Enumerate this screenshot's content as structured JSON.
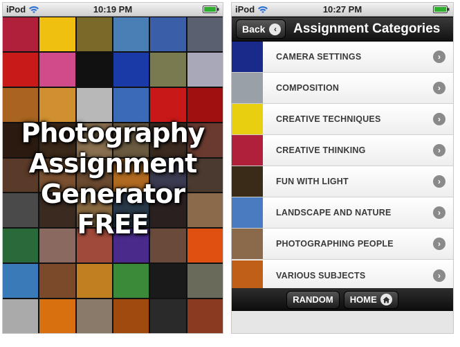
{
  "left_screen": {
    "status": {
      "carrier": "iPod",
      "time": "10:19 PM"
    },
    "title_lines": [
      "Photography",
      "Assignment",
      "Generator",
      "FREE"
    ],
    "tiles": [
      "#b0203a",
      "#f0c010",
      "#7a6a2a",
      "#4a7fb5",
      "#3a5ea8",
      "#5a6070",
      "#c91a1a",
      "#d14a8a",
      "#111111",
      "#1a3aa8",
      "#7a7a50",
      "#a8a8b8",
      "#a86420",
      "#d09030",
      "#b8b8b8",
      "#3a6ab8",
      "#c81818",
      "#a01010",
      "#2a1a10",
      "#3a2818",
      "#8a7050",
      "#6a5a40",
      "#3a2a20",
      "#6a3a30",
      "#5a3a28",
      "#7a5030",
      "#6a4a30",
      "#b06a20",
      "#3a3a50",
      "#4a3a30",
      "#4a4a4a",
      "#3a2a20",
      "#8a6a40",
      "#2a3a4a",
      "#2a2020",
      "#8a6a4a",
      "#2a6a3a",
      "#8a6a60",
      "#a04a3a",
      "#4a2a8a",
      "#6a4a3a",
      "#e05010",
      "#3a7ab8",
      "#7a4a2a",
      "#c08020",
      "#3a8a3a",
      "#1a1a1a",
      "#6a6a5a",
      "#aaaaaa",
      "#d87010",
      "#8a7a6a",
      "#a04a10",
      "#2a2a2a",
      "#8a3a20"
    ]
  },
  "right_screen": {
    "status": {
      "carrier": "iPod",
      "time": "10:27 PM"
    },
    "nav": {
      "back_label": "Back",
      "title": "Assignment Categories"
    },
    "categories": [
      {
        "label": "CAMERA SETTINGS",
        "thumb_color": "#1a2a8a"
      },
      {
        "label": "COMPOSITION",
        "thumb_color": "#9aa0a8"
      },
      {
        "label": "CREATIVE TECHNIQUES",
        "thumb_color": "#e8d010"
      },
      {
        "label": "CREATIVE THINKING",
        "thumb_color": "#b0203a"
      },
      {
        "label": "FUN WITH LIGHT",
        "thumb_color": "#3a2a18"
      },
      {
        "label": "LANDSCAPE AND NATURE",
        "thumb_color": "#4a7ac0"
      },
      {
        "label": "PHOTOGRAPHING PEOPLE",
        "thumb_color": "#8a6a4a"
      },
      {
        "label": "VARIOUS SUBJECTS",
        "thumb_color": "#c06018"
      }
    ],
    "toolbar": {
      "random_label": "RANDOM",
      "home_label": "HOME"
    }
  }
}
